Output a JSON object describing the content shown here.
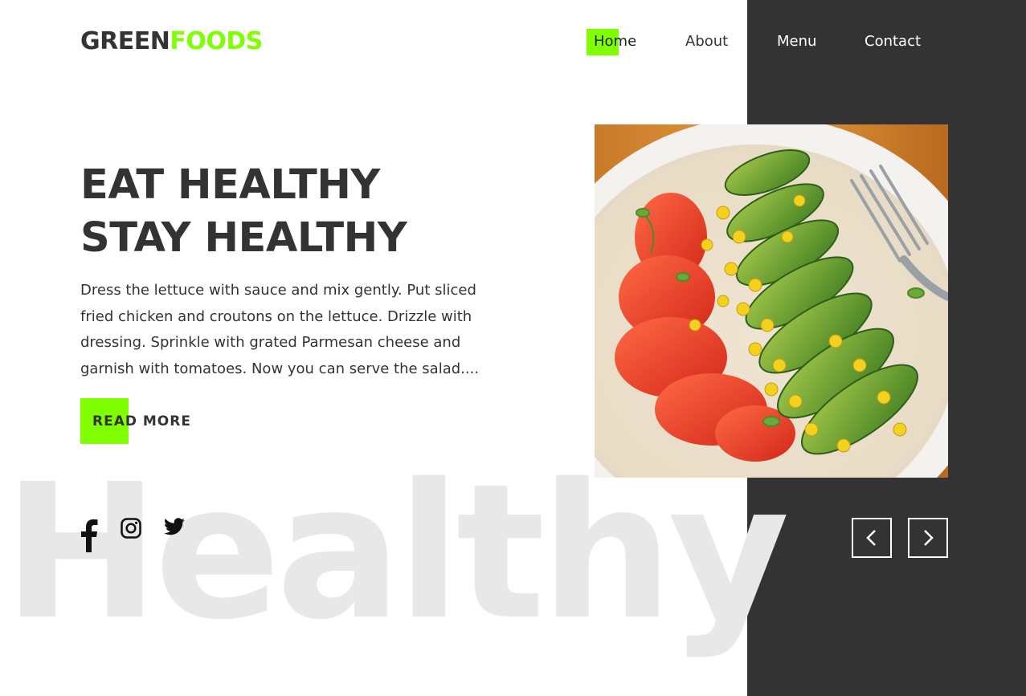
{
  "brand": {
    "part1": "GREEN",
    "part2": "FOODS"
  },
  "nav": {
    "items": [
      "Home",
      "About",
      "Menu",
      "Contact"
    ],
    "active": "Home"
  },
  "hero": {
    "headline_line1": "EAT HEALTHY",
    "headline_line2": "STAY HEALTHY",
    "description": "Dress the lettuce with sauce and mix gently. Put sliced fried chicken and croutons on the lettuce. Drizzle with dressing. Sprinkle with grated Parmesan cheese and garnish with tomatoes. Now you can serve the salad....",
    "cta_label": "READ MORE",
    "watermark": "Healthy",
    "image_icon": "salad-plate-image"
  },
  "social": {
    "icons": [
      "facebook-icon",
      "instagram-icon",
      "twitter-icon"
    ]
  },
  "slider": {
    "prev_icon": "chevron-left-icon",
    "next_icon": "chevron-right-icon"
  },
  "colors": {
    "accent": "#7fff00",
    "dark": "#333333",
    "watermark": "#e8e8e8",
    "background": "#ffffff"
  }
}
